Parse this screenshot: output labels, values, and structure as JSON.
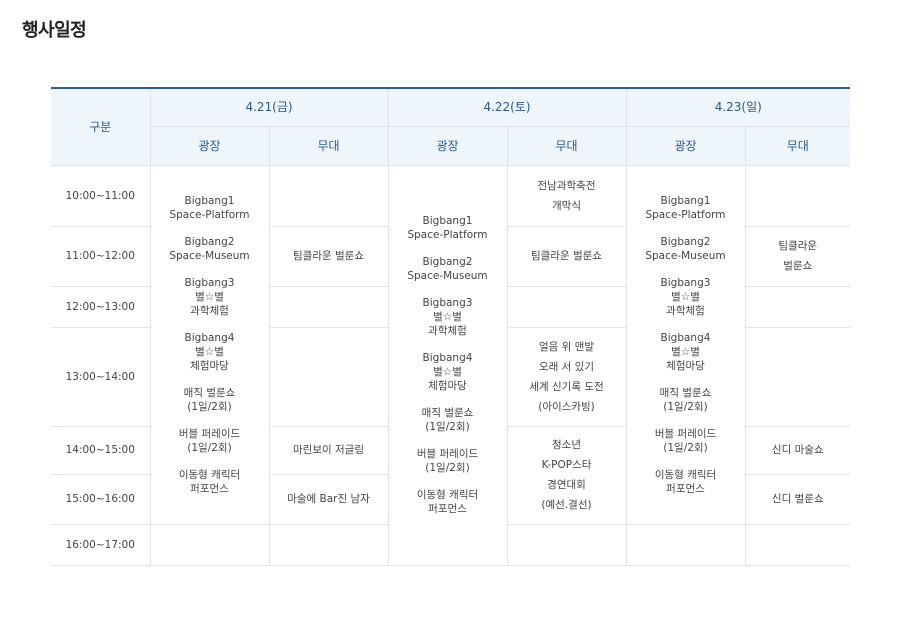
{
  "page_title": "행사일정",
  "header": {
    "category": "구분",
    "days": [
      "4.21(금)",
      "4.22(토)",
      "4.23(일)"
    ],
    "plaza": "광장",
    "stage": "무대"
  },
  "times": [
    "10:00~11:00",
    "11:00~12:00",
    "12:00~13:00",
    "13:00~14:00",
    "14:00~15:00",
    "15:00~16:00",
    "16:00~17:00"
  ],
  "plaza_program": [
    [
      "Bigbang1",
      "Space-Platform"
    ],
    [
      "Bigbang2",
      "Space-Museum"
    ],
    [
      "Bigbang3",
      "별☆별",
      "과학체험"
    ],
    [
      "Bigbang4",
      "별☆별",
      "체험마당"
    ],
    [
      "매직 벌룬쇼",
      "(1일/2회)"
    ],
    [
      "버블 퍼레이드",
      "(1일/2회)"
    ],
    [
      "이동형 캐릭터",
      "퍼포먼스"
    ]
  ],
  "day1_stage": {
    "r2": "팀클라운 벌룬쇼",
    "r5": "마린보이 저글링",
    "r6": "마술에 Bar진 남자"
  },
  "day2_stage": {
    "r1": [
      "전남과학축전",
      "개막식"
    ],
    "r2": "팀클라운 벌룬쇼",
    "r4": [
      "얼음 위 맨발",
      "오래 서 있기",
      "세계 신기록 도전",
      "(아이스카빙)"
    ],
    "r5": [
      "청소년",
      "K-POP스타",
      "경연대회",
      "(예선.결선)"
    ]
  },
  "day3_stage": {
    "r2": [
      "팀클라운",
      "벌룬쇼"
    ],
    "r5": "신디 마술쇼",
    "r6": "신디 벌룬쇼"
  }
}
